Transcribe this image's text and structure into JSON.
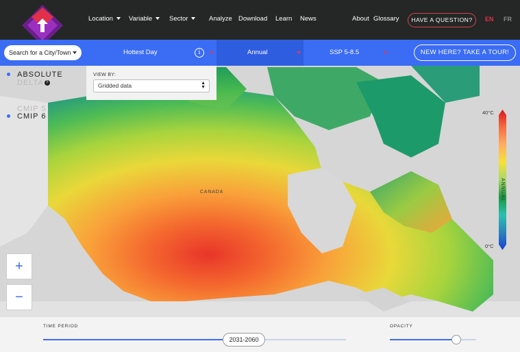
{
  "nav": {
    "items": [
      {
        "label": "Location",
        "caret": true
      },
      {
        "label": "Variable",
        "caret": true
      },
      {
        "label": "Sector",
        "caret": true
      },
      {
        "label": "Analyze",
        "caret": false
      },
      {
        "label": "Download",
        "caret": false
      },
      {
        "label": "Learn",
        "caret": false
      },
      {
        "label": "News",
        "caret": false
      },
      {
        "label": "About",
        "caret": false
      },
      {
        "label": "Glossary",
        "caret": false
      }
    ],
    "question_label": "HAVE A QUESTION?",
    "lang_en": "EN",
    "lang_fr": "FR"
  },
  "toolbar": {
    "city_search_label": "Search for a City/Town",
    "variable_label": "Hottest Day",
    "frequency_label": "Annual",
    "scenario_label": "SSP 5-8.5",
    "tour_label": "NEW HERE? TAKE A TOUR!"
  },
  "view_by": {
    "label": "VIEW BY:",
    "selected": "Gridded data"
  },
  "toggles": {
    "absolute": "ABSOLUTE",
    "delta": "DELTA",
    "cmip5": "CMIP 5",
    "cmip6": "CMIP 6"
  },
  "map": {
    "country_label": "CANADA"
  },
  "legend": {
    "max": "40°C",
    "min": "0°C",
    "period": "ANNUAL",
    "colors": [
      "#d7191c",
      "#f46d43",
      "#fdae61",
      "#f6e03a",
      "#a6d96a",
      "#1a9641",
      "#2bc0b0",
      "#2b83ba",
      "#1a3fd0"
    ]
  },
  "bottom": {
    "time_period_label": "TIME PERIOD",
    "time_period_value": "2031-2060",
    "time_period_progress": 0.66,
    "opacity_label": "OPACITY",
    "opacity_value": 0.77
  },
  "colors": {
    "accent": "#3a6cf4",
    "accent_dark": "#2f5de0",
    "brand_purple": "#7a2aa0",
    "brand_red": "#e03a5a"
  }
}
